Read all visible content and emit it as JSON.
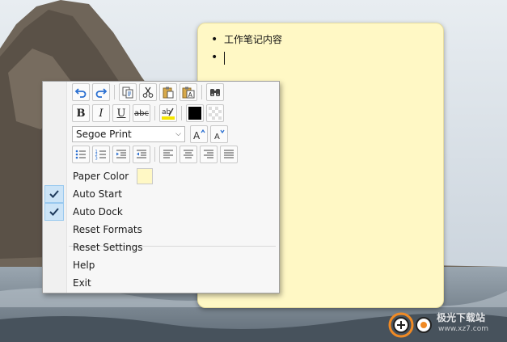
{
  "note": {
    "lines": [
      "工作笔记内容",
      ""
    ]
  },
  "menu": {
    "font_name": "Segoe Print",
    "toolbar_icons": [
      [
        "undo-icon",
        "redo-icon",
        "copy-icon",
        "cut-icon",
        "paste-icon",
        "paste-text-icon",
        "find-icon"
      ],
      [
        "bold-icon",
        "italic-icon",
        "underline-icon",
        "strikethrough-icon",
        "highlight-icon",
        "text-color-icon",
        "background-color-icon"
      ],
      [
        "grow-font-icon",
        "shrink-font-icon"
      ],
      [
        "bullet-list-icon",
        "numbered-list-icon",
        "indent-icon",
        "outdent-icon",
        "align-left-icon",
        "align-center-icon",
        "align-right-icon",
        "justify-icon"
      ]
    ],
    "format_labels": {
      "bold": "B",
      "italic": "I",
      "underline": "U",
      "strike": "abc",
      "highlight": "ab"
    },
    "items": [
      {
        "label": "Paper Color",
        "checked": false
      },
      {
        "label": "Auto Start",
        "checked": true
      },
      {
        "label": "Auto Dock",
        "checked": true
      },
      {
        "label": "Reset Formats",
        "checked": false
      },
      {
        "label": "Reset Settings",
        "checked": false
      },
      {
        "label": "Help",
        "checked": false
      },
      {
        "label": "Exit",
        "checked": false
      }
    ]
  },
  "watermark": {
    "text": "极光下载站",
    "url": "www.xz7.com"
  },
  "colors": {
    "note": "#fff8c5",
    "check_bg": "#cce4f7",
    "text_color": "#000000"
  }
}
